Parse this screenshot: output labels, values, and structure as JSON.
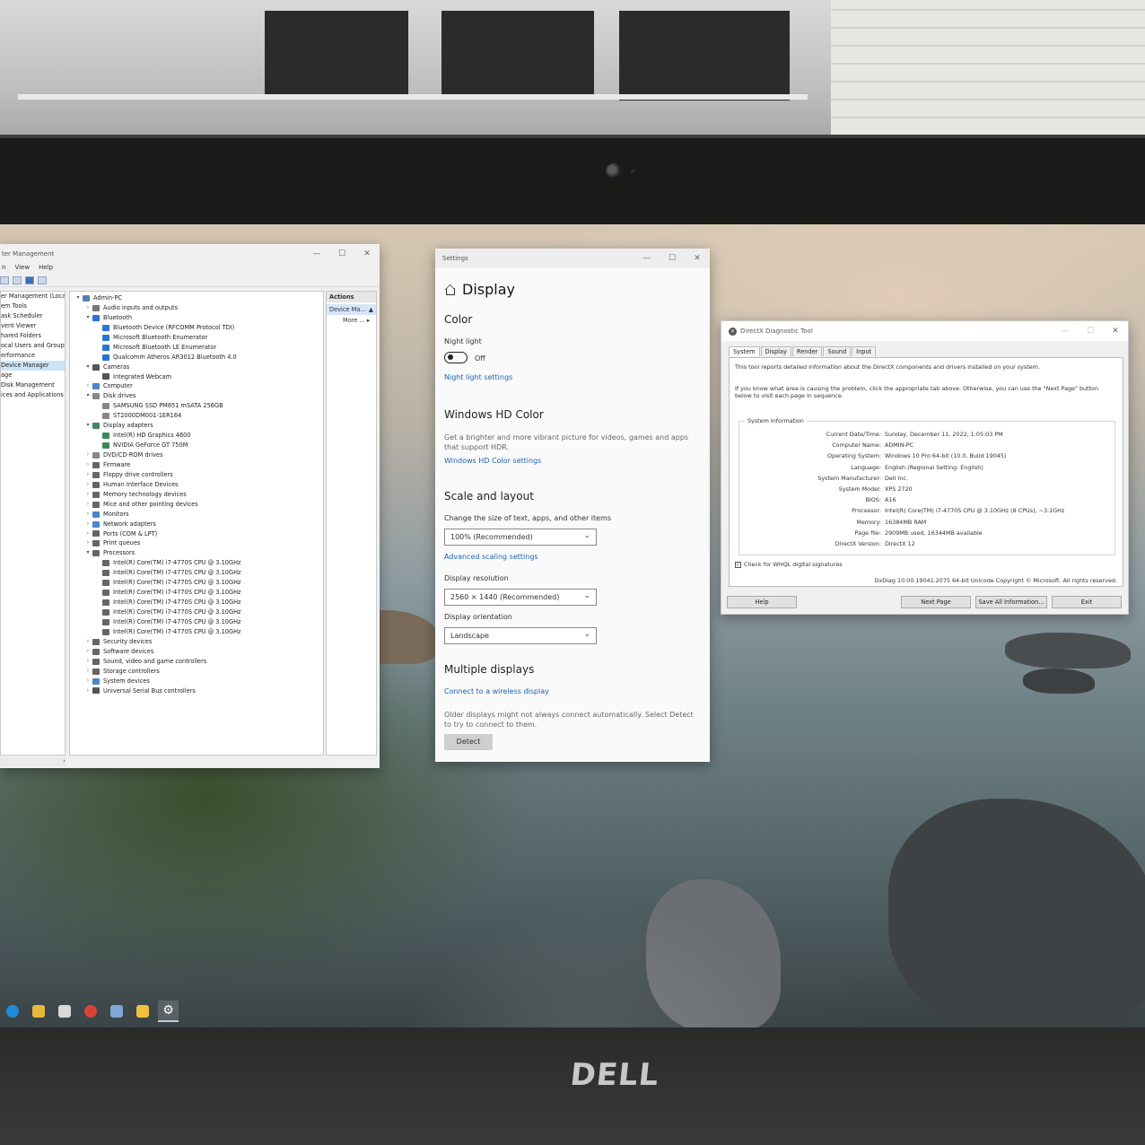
{
  "computer_management": {
    "title": "ter Management",
    "menu": [
      "n",
      "View",
      "Help"
    ],
    "nav": [
      {
        "label": "er Management (Local",
        "selected": false
      },
      {
        "label": "em Tools",
        "selected": false
      },
      {
        "label": "ask Scheduler",
        "selected": false
      },
      {
        "label": "vent Viewer",
        "selected": false
      },
      {
        "label": "hared Folders",
        "selected": false
      },
      {
        "label": "ocal Users and Groups",
        "selected": false
      },
      {
        "label": "erformance",
        "selected": false
      },
      {
        "label": "Device Manager",
        "selected": true
      },
      {
        "label": "age",
        "selected": false
      },
      {
        "label": "Disk Management",
        "selected": false
      },
      {
        "label": "ices and Applications",
        "selected": false
      }
    ],
    "tree": [
      {
        "label": "Admin-PC",
        "level": 0,
        "arrow": "▾",
        "icon": "computer-icon",
        "color": "#5a7fb0"
      },
      {
        "label": "Audio inputs and outputs",
        "level": 1,
        "arrow": "›",
        "icon": "speaker-icon",
        "color": "#777777"
      },
      {
        "label": "Bluetooth",
        "level": 1,
        "arrow": "▾",
        "icon": "bluetooth-icon",
        "color": "#2a74d4"
      },
      {
        "label": "Bluetooth Device (RFCOMM Protocol TDI)",
        "level": 2,
        "arrow": "",
        "icon": "bluetooth-icon",
        "color": "#2a74d4"
      },
      {
        "label": "Microsoft Bluetooth Enumerator",
        "level": 2,
        "arrow": "",
        "icon": "bluetooth-icon",
        "color": "#2a74d4"
      },
      {
        "label": "Microsoft Bluetooth LE Enumerator",
        "level": 2,
        "arrow": "",
        "icon": "bluetooth-icon",
        "color": "#2a74d4"
      },
      {
        "label": "Qualcomm Atheros AR3012 Bluetooth 4.0",
        "level": 2,
        "arrow": "",
        "icon": "bluetooth-icon",
        "color": "#2a74d4"
      },
      {
        "label": "Cameras",
        "level": 1,
        "arrow": "▾",
        "icon": "camera-icon",
        "color": "#555555"
      },
      {
        "label": "Integrated Webcam",
        "level": 2,
        "arrow": "",
        "icon": "camera-icon",
        "color": "#555555"
      },
      {
        "label": "Computer",
        "level": 1,
        "arrow": "›",
        "icon": "monitor-icon",
        "color": "#4a86c8"
      },
      {
        "label": "Disk drives",
        "level": 1,
        "arrow": "▾",
        "icon": "disk-icon",
        "color": "#888888"
      },
      {
        "label": "SAMSUNG SSD PM851 mSATA 256GB",
        "level": 2,
        "arrow": "",
        "icon": "disk-icon",
        "color": "#888888"
      },
      {
        "label": "ST2000DM001-1ER164",
        "level": 2,
        "arrow": "",
        "icon": "disk-icon",
        "color": "#888888"
      },
      {
        "label": "Display adapters",
        "level": 1,
        "arrow": "▾",
        "icon": "monitor-icon",
        "color": "#3a8a5a"
      },
      {
        "label": "Intel(R) HD Graphics 4600",
        "level": 2,
        "arrow": "",
        "icon": "monitor-icon",
        "color": "#3a8a5a"
      },
      {
        "label": "NVIDIA GeForce GT 750M",
        "level": 2,
        "arrow": "",
        "icon": "monitor-icon",
        "color": "#3a8a5a"
      },
      {
        "label": "DVD/CD-ROM drives",
        "level": 1,
        "arrow": "›",
        "icon": "dvd-icon",
        "color": "#888888"
      },
      {
        "label": "Firmware",
        "level": 1,
        "arrow": "›",
        "icon": "chip-icon",
        "color": "#666666"
      },
      {
        "label": "Floppy drive controllers",
        "level": 1,
        "arrow": "›",
        "icon": "floppy-icon",
        "color": "#666666"
      },
      {
        "label": "Human Interface Devices",
        "level": 1,
        "arrow": "›",
        "icon": "hid-icon",
        "color": "#666666"
      },
      {
        "label": "Memory technology devices",
        "level": 1,
        "arrow": "›",
        "icon": "memory-icon",
        "color": "#666666"
      },
      {
        "label": "Mice and other pointing devices",
        "level": 1,
        "arrow": "›",
        "icon": "mouse-icon",
        "color": "#666666"
      },
      {
        "label": "Monitors",
        "level": 1,
        "arrow": "›",
        "icon": "monitor-icon",
        "color": "#4a86c8"
      },
      {
        "label": "Network adapters",
        "level": 1,
        "arrow": "›",
        "icon": "network-icon",
        "color": "#4a86c8"
      },
      {
        "label": "Ports (COM & LPT)",
        "level": 1,
        "arrow": "›",
        "icon": "port-icon",
        "color": "#666666"
      },
      {
        "label": "Print queues",
        "level": 1,
        "arrow": "›",
        "icon": "printer-icon",
        "color": "#666666"
      },
      {
        "label": "Processors",
        "level": 1,
        "arrow": "▾",
        "icon": "cpu-icon",
        "color": "#666666"
      },
      {
        "label": "Intel(R) Core(TM) i7-4770S CPU @ 3.10GHz",
        "level": 2,
        "arrow": "",
        "icon": "cpu-icon",
        "color": "#666666"
      },
      {
        "label": "Intel(R) Core(TM) i7-4770S CPU @ 3.10GHz",
        "level": 2,
        "arrow": "",
        "icon": "cpu-icon",
        "color": "#666666"
      },
      {
        "label": "Intel(R) Core(TM) i7-4770S CPU @ 3.10GHz",
        "level": 2,
        "arrow": "",
        "icon": "cpu-icon",
        "color": "#666666"
      },
      {
        "label": "Intel(R) Core(TM) i7-4770S CPU @ 3.10GHz",
        "level": 2,
        "arrow": "",
        "icon": "cpu-icon",
        "color": "#666666"
      },
      {
        "label": "Intel(R) Core(TM) i7-4770S CPU @ 3.10GHz",
        "level": 2,
        "arrow": "",
        "icon": "cpu-icon",
        "color": "#666666"
      },
      {
        "label": "Intel(R) Core(TM) i7-4770S CPU @ 3.10GHz",
        "level": 2,
        "arrow": "",
        "icon": "cpu-icon",
        "color": "#666666"
      },
      {
        "label": "Intel(R) Core(TM) i7-4770S CPU @ 3.10GHz",
        "level": 2,
        "arrow": "",
        "icon": "cpu-icon",
        "color": "#666666"
      },
      {
        "label": "Intel(R) Core(TM) i7-4770S CPU @ 3.10GHz",
        "level": 2,
        "arrow": "",
        "icon": "cpu-icon",
        "color": "#666666"
      },
      {
        "label": "Security devices",
        "level": 1,
        "arrow": "›",
        "icon": "lock-icon",
        "color": "#666666"
      },
      {
        "label": "Software devices",
        "level": 1,
        "arrow": "›",
        "icon": "software-icon",
        "color": "#666666"
      },
      {
        "label": "Sound, video and game controllers",
        "level": 1,
        "arrow": "›",
        "icon": "speaker-icon",
        "color": "#666666"
      },
      {
        "label": "Storage controllers",
        "level": 1,
        "arrow": "›",
        "icon": "storage-icon",
        "color": "#666666"
      },
      {
        "label": "System devices",
        "level": 1,
        "arrow": "›",
        "icon": "system-icon",
        "color": "#4a86c8"
      },
      {
        "label": "Universal Serial Bus controllers",
        "level": 1,
        "arrow": "›",
        "icon": "usb-icon",
        "color": "#555555"
      }
    ],
    "actions": {
      "header": "Actions",
      "item": "Device Ma...",
      "more": "More ..."
    }
  },
  "settings": {
    "window_title": "Settings",
    "page_title": "Display",
    "color_heading": "Color",
    "night_light_label": "Night light",
    "night_light_state": "Off",
    "night_light_link": "Night light settings",
    "hd_heading": "Windows HD Color",
    "hd_desc": "Get a brighter and more vibrant picture for videos, games and apps that support HDR.",
    "hd_link": "Windows HD Color settings",
    "scale_heading": "Scale and layout",
    "scale_label": "Change the size of text, apps, and other items",
    "scale_value": "100% (Recommended)",
    "scale_link": "Advanced scaling settings",
    "resolution_label": "Display resolution",
    "resolution_value": "2560 × 1440 (Recommended)",
    "orientation_label": "Display orientation",
    "orientation_value": "Landscape",
    "multi_heading": "Multiple displays",
    "wireless_link": "Connect to a wireless display",
    "multi_desc": "Older displays might not always connect automatically. Select Detect to try to connect to them.",
    "detect_button": "Detect"
  },
  "dxdiag": {
    "title": "DirectX Diagnostic Tool",
    "tabs": [
      "System",
      "Display",
      "Render",
      "Sound",
      "Input"
    ],
    "intro1": "This tool reports detailed information about the DirectX components and drivers installed on your system.",
    "intro2": "If you know what area is causing the problem, click the appropriate tab above.  Otherwise, you can use the \"Next Page\" button below to visit each page in sequence.",
    "group_title": "System Information",
    "rows": [
      {
        "key": "Current Date/Time:",
        "value": "Sunday, December 11, 2022, 1:05:03 PM"
      },
      {
        "key": "Computer Name:",
        "value": "ADMIN-PC"
      },
      {
        "key": "Operating System:",
        "value": "Windows 10 Pro 64-bit (10.0, Build 19045)"
      },
      {
        "key": "Language:",
        "value": "English (Regional Setting: English)"
      },
      {
        "key": "System Manufacturer:",
        "value": "Dell Inc."
      },
      {
        "key": "System Model:",
        "value": "XPS 2720"
      },
      {
        "key": "BIOS:",
        "value": "A16"
      },
      {
        "key": "Processor:",
        "value": "Intel(R) Core(TM) i7-4770S CPU @ 3.10GHz (8 CPUs), ~3.1GHz"
      },
      {
        "key": "Memory:",
        "value": "16384MB RAM"
      },
      {
        "key": "Page file:",
        "value": "2909MB used, 16344MB available"
      },
      {
        "key": "DirectX Version:",
        "value": "DirectX 12"
      }
    ],
    "checkbox_label": "Check for WHQL digital signatures",
    "footer": "DxDiag 10.00.19041.2075 64-bit Unicode  Copyright © Microsoft. All rights reserved.",
    "buttons": {
      "help": "Help",
      "next": "Next Page",
      "save": "Save All Information...",
      "exit": "Exit"
    }
  },
  "taskbar": [
    {
      "name": "edge-icon",
      "color": "#1f8ad8"
    },
    {
      "name": "file-explorer-icon",
      "color": "#e8b63c"
    },
    {
      "name": "calendar-icon",
      "color": "#d9d9d9"
    },
    {
      "name": "chrome-icon",
      "color": "#d94335"
    },
    {
      "name": "device-manager-icon",
      "color": "#7fa6d8"
    },
    {
      "name": "dxdiag-icon",
      "color": "#f0c040"
    },
    {
      "name": "settings-gear-icon",
      "color": "#ffffff"
    }
  ],
  "brand_logo": "DELL"
}
